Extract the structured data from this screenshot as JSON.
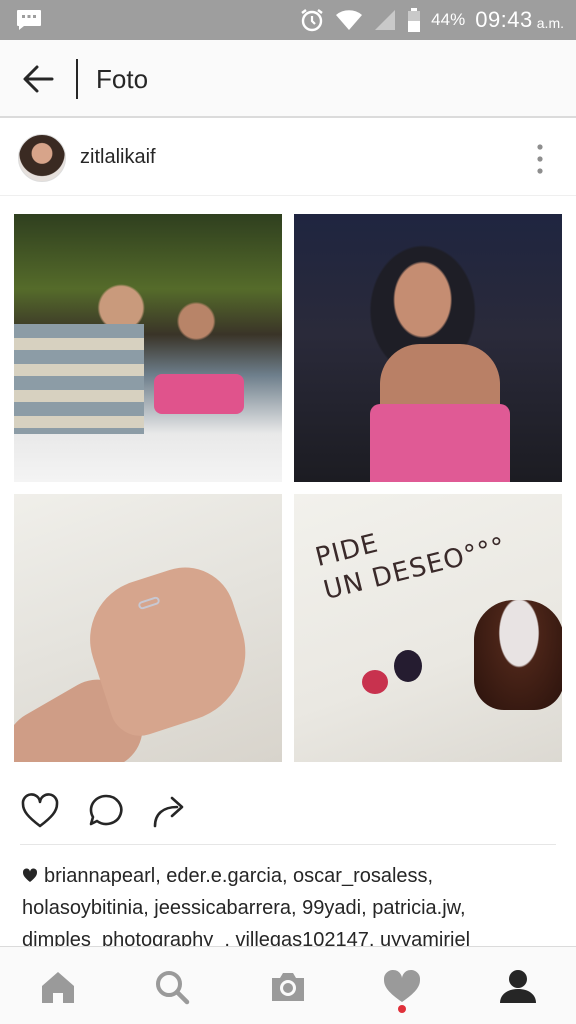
{
  "status_bar": {
    "battery": "44%",
    "time": "09:43",
    "ampm": "a.m."
  },
  "header": {
    "title": "Foto"
  },
  "post": {
    "username": "zitlalikaif",
    "image_text": "PIDE\nUN DESEO",
    "likes_text": "briannapearl, eder.e.garcia, oscar_rosaless, holasoybitinia, jeessicabarrera, 99yadi, patricia.jw, dimples_photography_, villegas102147, uyvamiriel"
  },
  "colors": {
    "status_bar": "#9e9e9e",
    "accent_like_dot": "#e0303a",
    "text": "#262626"
  },
  "icons": {
    "status": [
      "message-icon",
      "alarm-icon",
      "wifi-icon",
      "signal-icon",
      "battery-icon"
    ],
    "actions": [
      "like-icon",
      "comment-icon",
      "share-icon"
    ],
    "nav": [
      "home-icon",
      "search-icon",
      "camera-icon",
      "activity-heart-icon",
      "profile-icon"
    ]
  }
}
